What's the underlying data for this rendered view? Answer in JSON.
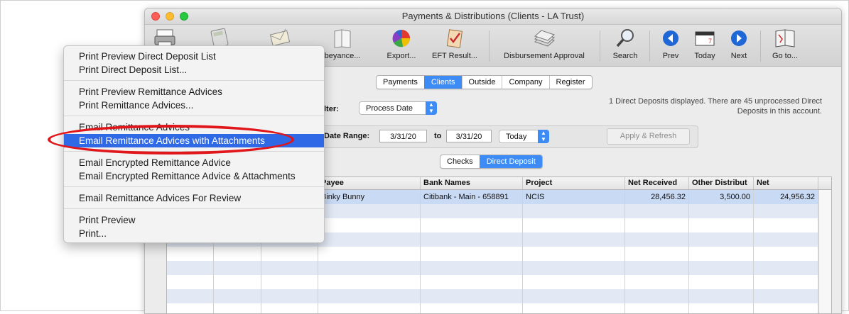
{
  "window": {
    "title": "Payments & Distributions (Clients - LA Trust)"
  },
  "toolbar": {
    "items": [
      {
        "label": "",
        "icon": "printer-icon"
      },
      {
        "label": "",
        "icon": "calculator-icon"
      },
      {
        "label": "",
        "icon": "envelope-icon"
      },
      {
        "label": "beyance...",
        "icon": "book-icon"
      },
      {
        "label": "Export...",
        "icon": "pie-chart-icon"
      },
      {
        "label": "EFT Result...",
        "icon": "checklist-icon"
      },
      {
        "label": "Disbursement Approval",
        "icon": "money-stack-icon"
      },
      {
        "label": "Search",
        "icon": "magnifier-icon"
      },
      {
        "label": "Prev",
        "icon": "prev-arrow-icon"
      },
      {
        "label": "Today",
        "icon": "calendar-icon"
      },
      {
        "label": "Next",
        "icon": "next-arrow-icon"
      },
      {
        "label": "Go to...",
        "icon": "map-book-icon"
      }
    ]
  },
  "view_tabs": [
    "Payments",
    "Clients",
    "Outside",
    "Company",
    "Register"
  ],
  "view_tabs_selected": "Clients",
  "filter": {
    "label": "lter:",
    "value": "Process Date"
  },
  "date_range": {
    "label": "Date Range:",
    "from": "3/31/20",
    "to_label": "to",
    "to": "3/31/20",
    "preset": "Today",
    "apply_label": "Apply & Refresh"
  },
  "status": {
    "line1": "1 Direct Deposits displayed. There are 45 unprocessed Direct",
    "line2": "Deposits in this account."
  },
  "type_tabs": [
    "Checks",
    "Direct Deposit"
  ],
  "type_tabs_selected": "Direct Deposit",
  "table": {
    "columns": [
      "Payee",
      "Bank Names",
      "Project",
      "Net Received",
      "Other Distribut",
      "Net"
    ],
    "rows": [
      {
        "payee": "Binky Bunny",
        "bank": "Citibank - Main - 658891",
        "project": "NCIS",
        "net_received": "28,456.32",
        "other": "3,500.00",
        "net": "24,956.32"
      }
    ]
  },
  "menu": {
    "items": [
      "Print Preview Direct Deposit List",
      "Print Direct Deposit List...",
      "Print Preview Remittance Advices",
      "Print Remittance Advices...",
      "Email Remittance Advices",
      "Email Remittance Advices with Attachments",
      "Email Encrypted Remittance Advice",
      "Email Encrypted Remittance Advice & Attachments",
      "Email Remittance Advices For Review",
      "Print Preview",
      "Print..."
    ],
    "highlighted": "Email Remittance Advices with Attachments"
  },
  "colors": {
    "accent": "#3d8bf5",
    "menu_highlight": "#2f69e6",
    "annotation": "#e0161a",
    "row_stripe": "#e2e9f5",
    "row_selected": "#c9daf5"
  }
}
